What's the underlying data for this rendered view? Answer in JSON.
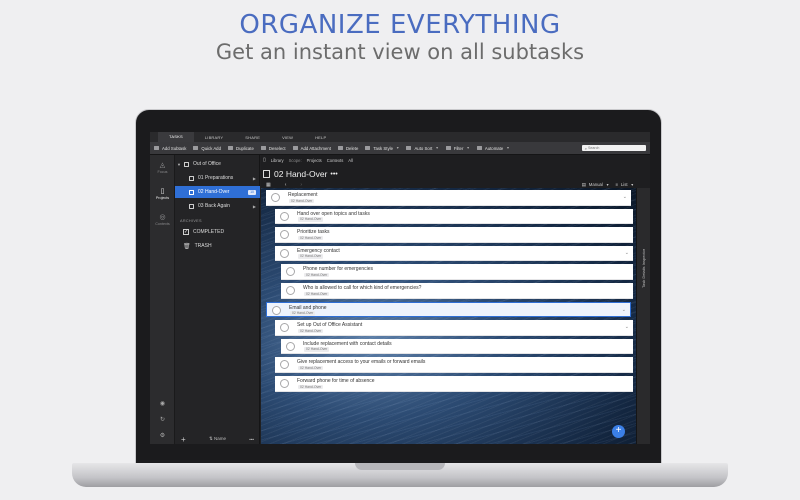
{
  "hero": {
    "title": "ORGANIZE EVERYTHING",
    "subtitle": "Get an instant view on all subtasks"
  },
  "colors": {
    "accent": "#2f6fd6",
    "headline": "#4a6cc0",
    "background": "#efeff1"
  },
  "app": {
    "menubar": [
      "TASKS",
      "LIBRARY",
      "SHARE",
      "VIEW",
      "HELP"
    ],
    "active_menu": "TASKS",
    "toolbar": [
      {
        "label": "Add Subtask",
        "icon": "add-subtask-icon"
      },
      {
        "label": "Quick Add",
        "icon": "quick-add-icon"
      },
      {
        "label": "Duplicate",
        "icon": "duplicate-icon"
      },
      {
        "label": "Deselect",
        "icon": "deselect-icon"
      },
      {
        "label": "Add Attachment",
        "icon": "attachment-icon"
      },
      {
        "label": "Delete",
        "icon": "trash-icon"
      },
      {
        "label": "Task Style",
        "icon": "task-style-icon"
      },
      {
        "label": "Auto Sort",
        "icon": "sort-icon"
      },
      {
        "label": "Filter",
        "icon": "filter-icon"
      },
      {
        "label": "Automate",
        "icon": "automate-icon"
      }
    ],
    "search_placeholder": "Search",
    "rail": {
      "focus": "Focus",
      "projects": "Projects",
      "contexts": "Contexts"
    },
    "sidebar": {
      "parent": "Out of Office",
      "items": [
        {
          "label": "01 Preparations"
        },
        {
          "label": "02 Hand-Over",
          "badge": "10"
        },
        {
          "label": "03 Back Again"
        }
      ],
      "archives_label": "ARCHIVES",
      "completed": "COMPLETED",
      "trash": "TRASH",
      "sort_label": "⇅ Name",
      "more": "•••"
    },
    "breadcrumbs": {
      "library": "Library",
      "scope": "Scope:",
      "projects": "Projects",
      "contexts": "Contexts",
      "all": "All"
    },
    "project_title": "02 Hand-Over",
    "project_more": "•••",
    "view": {
      "sort": "Manual",
      "layout": "List"
    },
    "inspector_label": "Task Details Inspector",
    "tasks": [
      {
        "name": "Replacement",
        "tag": "02 Hand-Over",
        "indent": 0,
        "expand": true
      },
      {
        "name": "Hand over open topics and tasks",
        "tag": "02 Hand-Over",
        "indent": 1
      },
      {
        "name": "Prioritize tasks",
        "tag": "02 Hand-Over",
        "indent": 1
      },
      {
        "name": "Emergency contact",
        "tag": "02 Hand-Over",
        "indent": 1,
        "expand": true
      },
      {
        "name": "Phone number for emergencies",
        "tag": "02 Hand-Over",
        "indent": 2
      },
      {
        "name": "Who is allowed to call for which kind of emergencies?",
        "tag": "02 Hand-Over",
        "indent": 2
      },
      {
        "name": "Email and phone",
        "tag": "02 Hand-Over",
        "indent": 0,
        "expand": true,
        "selected": true
      },
      {
        "name": "Set up Out of Office Assistant",
        "tag": "02 Hand-Over",
        "indent": 1,
        "expand": true
      },
      {
        "name": "Include replacement with contact details",
        "tag": "02 Hand-Over",
        "indent": 2
      },
      {
        "name": "Give replacement access to your emails or forward emails",
        "tag": "02 Hand-Over",
        "indent": 1
      },
      {
        "name": "Forward phone for time of absence",
        "tag": "02 Hand-Over",
        "indent": 1
      }
    ]
  }
}
